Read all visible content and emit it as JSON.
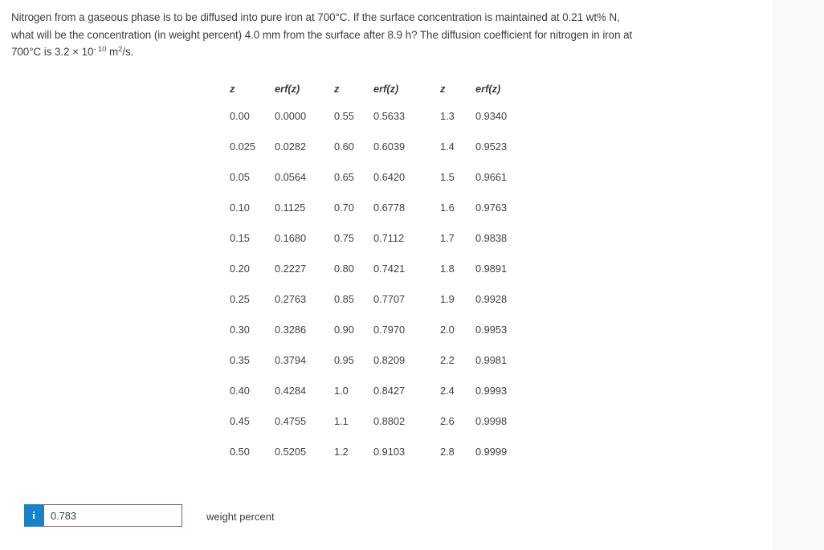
{
  "question": {
    "line1": "Nitrogen from a gaseous phase is to be diffused into pure iron at 700°C. If the surface concentration is maintained at  0.21 wt% N,",
    "line2": "what will be the concentration (in weight percent)  4.0 mm from the surface after  8.9 h? The diffusion coefficient for nitrogen in iron at",
    "line3_pre": "700°C is  3.2 × 10",
    "line3_exp": "- 10",
    "line3_mid": " m",
    "line3_exp2": "2",
    "line3_post": "/s."
  },
  "table": {
    "headers": [
      "z",
      "erf(z)",
      "z",
      "erf(z)",
      "z",
      "erf(z)"
    ],
    "rows": [
      [
        "0.00",
        "0.0000",
        "0.55",
        "0.5633",
        "1.3",
        "0.9340"
      ],
      [
        "0.025",
        "0.0282",
        "0.60",
        "0.6039",
        "1.4",
        "0.9523"
      ],
      [
        "0.05",
        "0.0564",
        "0.65",
        "0.6420",
        "1.5",
        "0.9661"
      ],
      [
        "0.10",
        "0.1125",
        "0.70",
        "0.6778",
        "1.6",
        "0.9763"
      ],
      [
        "0.15",
        "0.1680",
        "0.75",
        "0.7112",
        "1.7",
        "0.9838"
      ],
      [
        "0.20",
        "0.2227",
        "0.80",
        "0.7421",
        "1.8",
        "0.9891"
      ],
      [
        "0.25",
        "0.2763",
        "0.85",
        "0.7707",
        "1.9",
        "0.9928"
      ],
      [
        "0.30",
        "0.3286",
        "0.90",
        "0.7970",
        "2.0",
        "0.9953"
      ],
      [
        "0.35",
        "0.3794",
        "0.95",
        "0.8209",
        "2.2",
        "0.9981"
      ],
      [
        "0.40",
        "0.4284",
        "1.0",
        "0.8427",
        "2.4",
        "0.9993"
      ],
      [
        "0.45",
        "0.4755",
        "1.1",
        "0.8802",
        "2.6",
        "0.9998"
      ],
      [
        "0.50",
        "0.5205",
        "1.2",
        "0.9103",
        "2.8",
        "0.9999"
      ]
    ]
  },
  "answer": {
    "info_icon_label": "i",
    "value": "0.783",
    "placeholder": "",
    "unit_label": "weight percent"
  },
  "colors": {
    "page_background": "#ffffff",
    "text": "#3d3d40",
    "info_icon_background": "#1583c8",
    "input_border": "#8d5c57",
    "right_rail_background": "#fafafb"
  }
}
